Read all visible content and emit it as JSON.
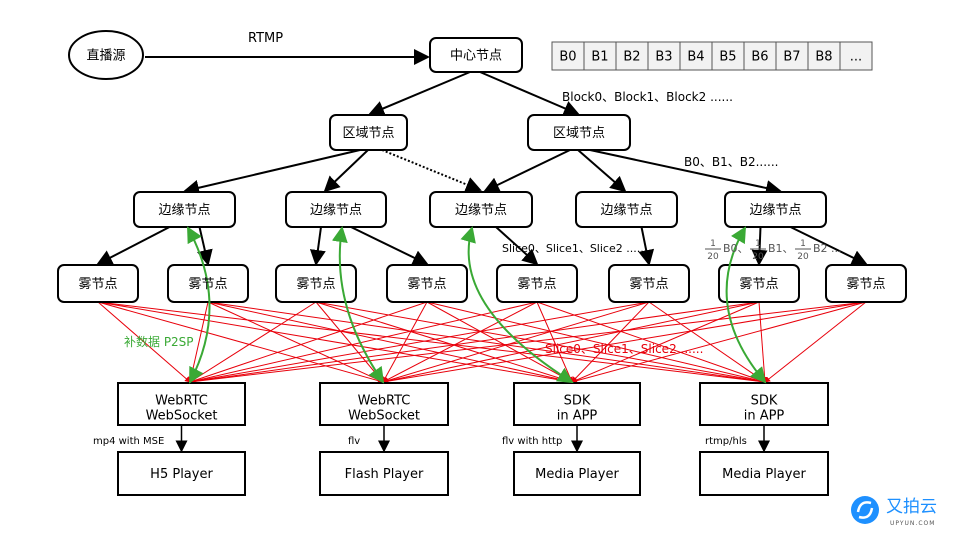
{
  "source": "直播源",
  "protocol": "RTMP",
  "center": "中心节点",
  "blocks": [
    "B0",
    "B1",
    "B2",
    "B3",
    "B4",
    "B5",
    "B6",
    "B7",
    "B8",
    "..."
  ],
  "block_note": "Block0、Block1、Block2 ......",
  "regions": [
    "区域节点",
    "区域节点"
  ],
  "region_note": "B0、B1、B2......",
  "edges": [
    "边缘节点",
    "边缘节点",
    "边缘节点",
    "边缘节点",
    "边缘节点"
  ],
  "slice_note": "Slice0、Slice1、Slice2 ......",
  "fraction_note": {
    "num": "1",
    "den": "20",
    "items": [
      "B0、",
      "B1、",
      "B2 ..."
    ]
  },
  "fogs": [
    "雾节点",
    "雾节点",
    "雾节点",
    "雾节点",
    "雾节点",
    "雾节点",
    "雾节点",
    "雾节点"
  ],
  "p2sp_note": "补数据 P2SP",
  "red_slice_note": "Slice0、Slice1、Slice2 ......",
  "clients": [
    [
      "WebRTC",
      "WebSocket"
    ],
    [
      "WebRTC",
      "WebSocket"
    ],
    [
      "SDK",
      "in APP"
    ],
    [
      "SDK",
      "in APP"
    ]
  ],
  "formats": [
    "mp4 with MSE",
    "flv",
    "flv with http",
    "rtmp/hls"
  ],
  "players": [
    "H5 Player",
    "Flash Player",
    "Media Player",
    "Media Player"
  ],
  "logo": {
    "name": "又拍云",
    "sub": "UPYUN.COM"
  },
  "colors": {
    "p2p_lines": "#e8000b",
    "p2sp_arrows": "#3aa935",
    "logo": "#1e90ff"
  }
}
